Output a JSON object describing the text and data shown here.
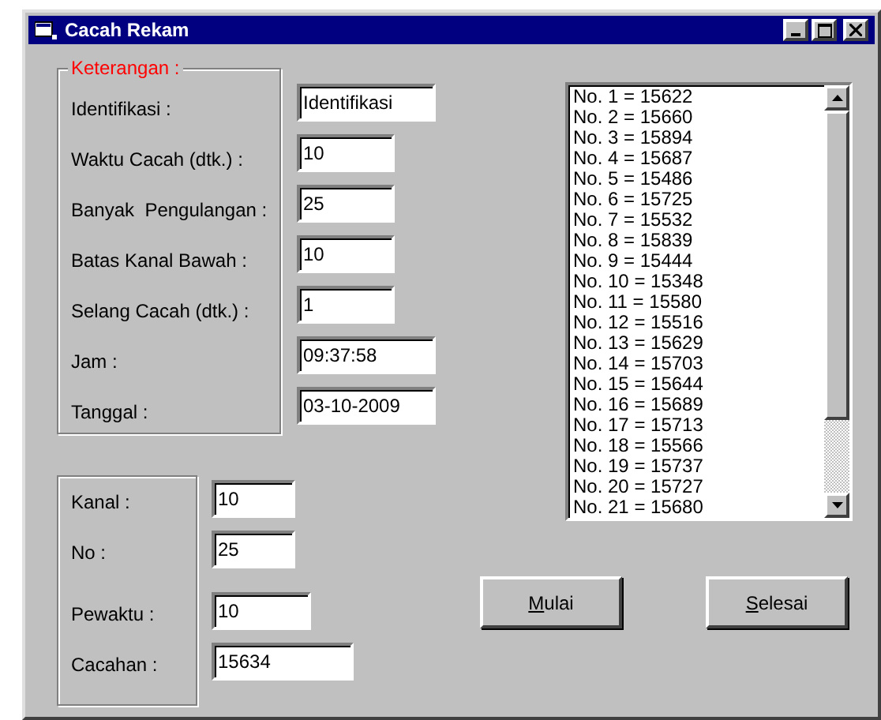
{
  "window": {
    "title": "Cacah Rekam"
  },
  "keterangan": {
    "legend": "Keterangan :",
    "fields": [
      {
        "label": "Identifikasi :",
        "value": "Identifikasi"
      },
      {
        "label": "Waktu Cacah (dtk.) :",
        "value": "10"
      },
      {
        "label": "Banyak  Pengulangan :",
        "value": "25"
      },
      {
        "label": "Batas Kanal Bawah :",
        "value": "10"
      },
      {
        "label": "Selang Cacah (dtk.) :",
        "value": "1"
      },
      {
        "label": "Jam :",
        "value": "09:37:58"
      },
      {
        "label": "Tanggal :",
        "value": "03-10-2009"
      }
    ]
  },
  "hasil": {
    "fields": [
      {
        "label": "Kanal :",
        "value": "10"
      },
      {
        "label": "No :",
        "value": "25"
      },
      {
        "label": "Pewaktu :",
        "value": "10"
      },
      {
        "label": "Cacahan :",
        "value": "15634"
      }
    ]
  },
  "list": {
    "items": [
      "No. 1 = 15622",
      "No. 2 = 15660",
      "No. 3 = 15894",
      "No. 4 = 15687",
      "No. 5 = 15486",
      "No. 6 = 15725",
      "No. 7 = 15532",
      "No. 8 = 15839",
      "No. 9 = 15444",
      "No. 10 = 15348",
      "No. 11 = 15580",
      "No. 12 = 15516",
      "No. 13 = 15629",
      "No. 14 = 15703",
      "No. 15 = 15644",
      "No. 16 = 15689",
      "No. 17 = 15713",
      "No. 18 = 15566",
      "No. 19 = 15737",
      "No. 20 = 15727",
      "No. 21 = 15680"
    ]
  },
  "buttons": [
    {
      "label": "Mulai"
    },
    {
      "label": "Selesai"
    }
  ]
}
